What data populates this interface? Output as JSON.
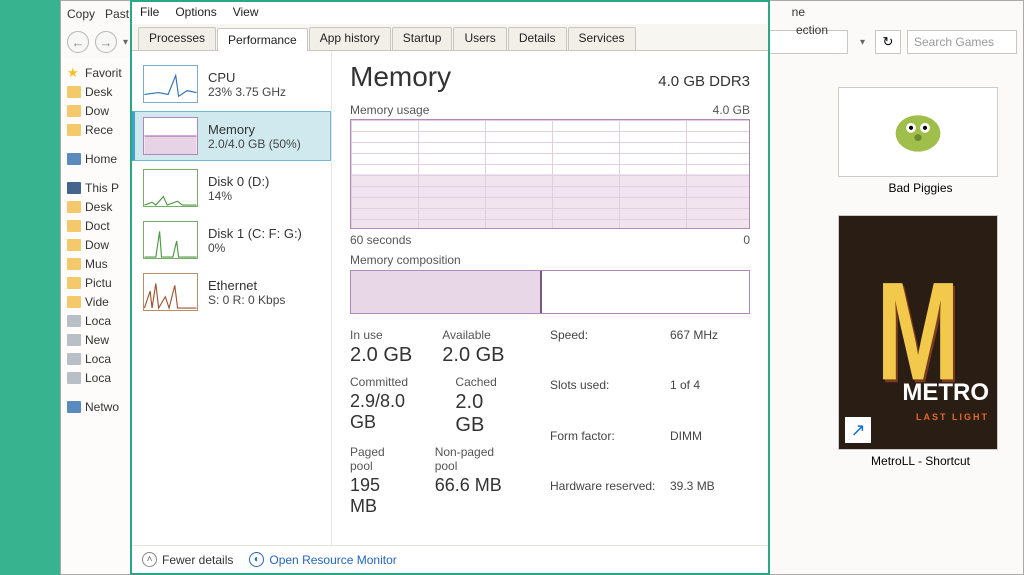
{
  "explorer": {
    "toolbar": {
      "copy": "Copy",
      "paste": "Past"
    },
    "nav": {
      "back": "←",
      "forward": "→",
      "dropdown": "▾",
      "refresh": "↻"
    },
    "search_placeholder": "Search Games",
    "tree": {
      "favorites": "Favorit",
      "items1": [
        "Desk",
        "Dow",
        "Rece"
      ],
      "home": "Home",
      "thispc": "This P",
      "items2": [
        "Desk",
        "Doct",
        "Dow",
        "Mus",
        "Pictu",
        "Vide",
        "Loca",
        "New",
        "Loca",
        "Loca"
      ],
      "network": "Netwo"
    },
    "thumbs": {
      "bad_piggies": "Bad Piggies",
      "metro": "MetroLL - Shortcut"
    },
    "obscured": {
      "top1": "ne",
      "top2": "ection"
    }
  },
  "taskmgr": {
    "menu": {
      "file": "File",
      "options": "Options",
      "view": "View"
    },
    "tabs": {
      "processes": "Processes",
      "performance": "Performance",
      "app_history": "App history",
      "startup": "Startup",
      "users": "Users",
      "details": "Details",
      "services": "Services"
    },
    "side": {
      "cpu": {
        "title": "CPU",
        "sub": "23% 3.75 GHz"
      },
      "memory": {
        "title": "Memory",
        "sub": "2.0/4.0 GB (50%)"
      },
      "disk0": {
        "title": "Disk 0 (D:)",
        "sub": "14%"
      },
      "disk1": {
        "title": "Disk 1 (C: F: G:)",
        "sub": "0%"
      },
      "eth": {
        "title": "Ethernet",
        "sub": "S: 0 R: 0 Kbps"
      }
    },
    "main": {
      "title": "Memory",
      "capacity": "4.0 GB DDR3",
      "usage_label": "Memory usage",
      "usage_max": "4.0 GB",
      "time_left": "60 seconds",
      "time_right": "0",
      "composition_label": "Memory composition",
      "stats": {
        "inuse_l": "In use",
        "inuse_v": "2.0 GB",
        "avail_l": "Available",
        "avail_v": "2.0 GB",
        "commit_l": "Committed",
        "commit_v": "2.9/8.0 GB",
        "cached_l": "Cached",
        "cached_v": "2.0 GB",
        "paged_l": "Paged pool",
        "paged_v": "195 MB",
        "nonpaged_l": "Non-paged pool",
        "nonpaged_v": "66.6 MB"
      },
      "kv": {
        "speed_l": "Speed:",
        "speed_v": "667 MHz",
        "slots_l": "Slots used:",
        "slots_v": "1 of 4",
        "form_l": "Form factor:",
        "form_v": "DIMM",
        "hw_l": "Hardware reserved:",
        "hw_v": "39.3 MB"
      }
    },
    "footer": {
      "fewer": "Fewer details",
      "resmon": "Open Resource Monitor"
    }
  }
}
